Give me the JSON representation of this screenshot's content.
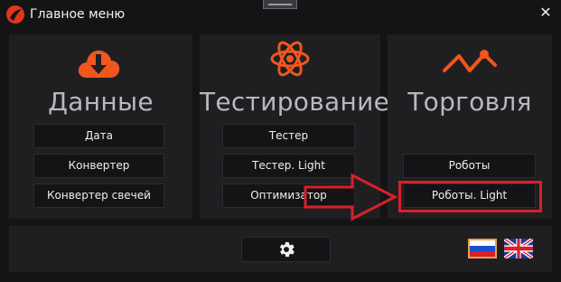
{
  "window": {
    "title": "Главное меню",
    "logo_icon": "app-logo",
    "close_icon": "close-icon"
  },
  "colors": {
    "accent": "#f0561e",
    "highlight": "#d8202a",
    "panel": "#1f1f22",
    "background": "#141416"
  },
  "panels": {
    "data": {
      "title": "Данные",
      "icon": "cloud-download-icon",
      "buttons": [
        "Дата",
        "Конвертер",
        "Конвертер свечей"
      ]
    },
    "testing": {
      "title": "Тестирование",
      "icon": "atom-icon",
      "buttons": [
        "Тестер",
        "Тестер. Light",
        "Оптимизатор"
      ]
    },
    "trading": {
      "title": "Торговля",
      "icon": "trend-line-icon",
      "buttons": [
        "Роботы",
        "Роботы. Light"
      ]
    }
  },
  "footer": {
    "settings_icon": "gear-icon",
    "languages": [
      "ru-flag-icon",
      "uk-flag-icon"
    ],
    "selected_language": "ru-flag-icon"
  },
  "annotation": {
    "arrow": "red-arrow",
    "highlighted_button": "Роботы. Light"
  }
}
